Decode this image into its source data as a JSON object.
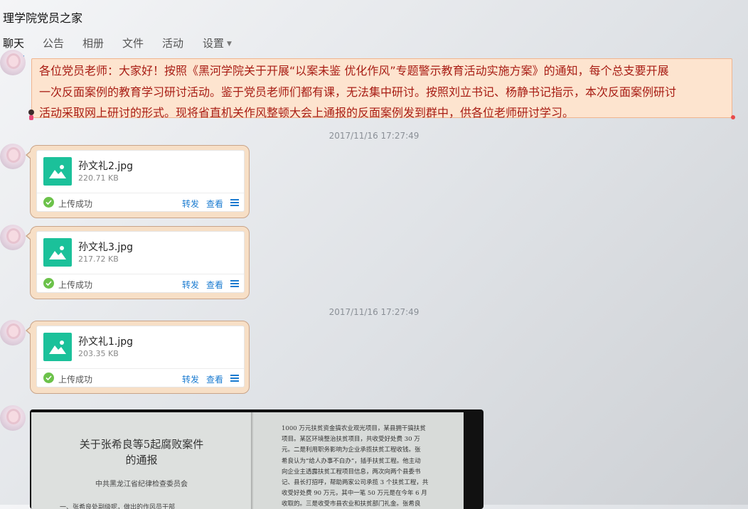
{
  "window": {
    "title": "理学院党员之家"
  },
  "tabs": [
    {
      "label": "聊天"
    },
    {
      "label": "公告"
    },
    {
      "label": "相册"
    },
    {
      "label": "文件"
    },
    {
      "label": "活动"
    },
    {
      "label": "设置"
    }
  ],
  "notice": {
    "lines": [
      "各位党员老师：大家好！按照《黑河学院关于开展“以案未鉴 优化作风”专题警示教育活动实施方案》的通知，每个总支要开展",
      "一次反面案例的教育学习研讨活动。鉴于党员老师们都有课，无法集中研讨。按照刘立书记、杨静书记指示，本次反面案例研讨",
      "活动采取网上研讨的形式。现将省直机关作风整顿大会上通报的反面案例发到群中，供各位老师研讨学习。"
    ]
  },
  "timestamps": [
    "2017/11/16 17:27:49",
    "2017/11/16 17:27:49"
  ],
  "files": [
    {
      "name": "孙文礼2.jpg",
      "size": "220.71 KB",
      "status": "上传成功",
      "forward": "转发",
      "view": "查看"
    },
    {
      "name": "孙文礼3.jpg",
      "size": "217.72 KB",
      "status": "上传成功",
      "forward": "转发",
      "view": "查看"
    },
    {
      "name": "孙文礼1.jpg",
      "size": "203.35 KB",
      "status": "上传成功",
      "forward": "转发",
      "view": "查看"
    }
  ],
  "document": {
    "title_line1": "关于张希良等5起腐败案件",
    "title_line2": "的通报",
    "issuer": "中共黑龙江省纪律检查委员会",
    "left_snippet": "一、张希良处副级呢，做出的作风员干部",
    "right_lines": [
      "1000 万元扶贫资金搞农业观光项目，某县拥干搞扶贫",
      "项目。某区环境整治扶贫项目，共收受好处费 30 万",
      "元。二是利用职务影响为企业承揽扶贫工程收钱。张",
      "希良认为“给人办事不白办”，插手扶贫工程。他主动",
      "向企业主透露扶贫工程项目信息，两次向两个县委书",
      "记、县长打招呼，帮助两家公司承揽 3 个扶贫工程，共",
      "收受好处费 90 万元，其中一笔 50 万元是在今年 6 月",
      "收取的。三是收受市县农业和扶贫部门礼金。张希良"
    ]
  },
  "colors": {
    "accent": "#1a8fe0",
    "notice_text": "#a81d14",
    "notice_bg": "#fde4cf",
    "file_icon": "#1bc19a",
    "success": "#6cc24a",
    "link": "#1a7bd0"
  }
}
